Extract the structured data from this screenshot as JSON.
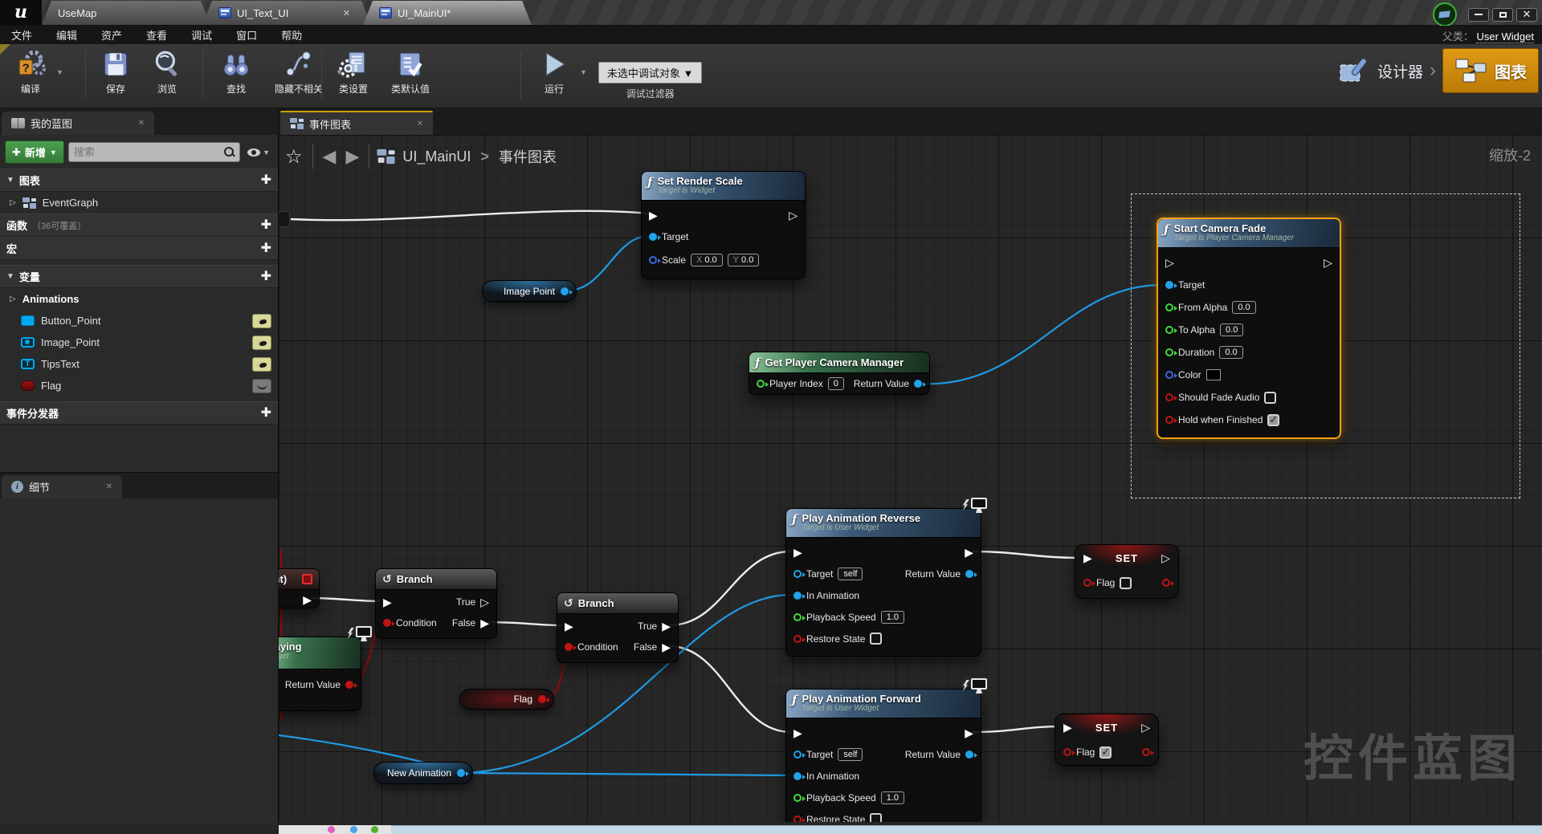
{
  "colors": {
    "accent_orange": "#e8940a",
    "selection_orange": "#f7a20c",
    "exec_wire": "#ececec",
    "object_pin_blue": "#22a3ea",
    "float_pin_green": "#41d93c",
    "bool_pin_red": "#c01414",
    "bool_wire_dark_red": "#8c0b0b",
    "pure_header_green": "#38714c",
    "function_header_blue": "#3c5a78",
    "add_button_green": "#4aa04e"
  },
  "titlebar": {
    "tabs": [
      {
        "label": "UseMap"
      },
      {
        "label": "UI_Text_UI"
      },
      {
        "label": "UI_MainUI*"
      }
    ]
  },
  "menu": {
    "items": [
      "文件",
      "编辑",
      "资产",
      "查看",
      "调试",
      "窗口",
      "帮助"
    ]
  },
  "toolbar": {
    "compile": "编译",
    "save": "保存",
    "browse": "浏览",
    "find": "查找",
    "hide_unrelated": "隐藏不相关",
    "class_settings": "类设置",
    "class_defaults": "类默认值",
    "play": "运行",
    "debug_object": "未选中调试对象 ▼",
    "debug_filter": "调试过滤器"
  },
  "header_right": {
    "parent_class_label": "父类：",
    "parent_class": "User Widget",
    "designer": "设计器",
    "graph": "图表"
  },
  "my_blueprint": {
    "title": "我的蓝图",
    "add_new": "新增",
    "search_placeholder": "搜索",
    "graphs_header": "图表",
    "event_graph": "EventGraph",
    "functions_header": "函数",
    "functions_hint": "（36可覆盖）",
    "macros_header": "宏",
    "variables_header": "变量",
    "animations_group": "Animations",
    "variables": [
      {
        "name": "Button_Point"
      },
      {
        "name": "Image_Point"
      },
      {
        "name": "TipsText"
      },
      {
        "name": "Flag"
      }
    ],
    "dispatchers_header": "事件分发器"
  },
  "details": {
    "title": "细节"
  },
  "graph": {
    "tab": "事件图表",
    "breadcrumb_root": "UI_MainUI",
    "breadcrumb_sep": ">",
    "breadcrumb_leaf": "事件图表",
    "zoom": "缩放-2",
    "watermark": "控件蓝图",
    "nodes": {
      "set_render_scale": {
        "title": "Set Render Scale",
        "subtitle": "Target is Widget",
        "target": "Target",
        "scale": "Scale",
        "x": "X",
        "x_value": "0.0",
        "y": "Y",
        "y_value": "0.0"
      },
      "image_point": {
        "label": "Image Point"
      },
      "get_pcm": {
        "title": "Get Player Camera Manager",
        "player_index": "Player Index",
        "player_index_value": "0",
        "return_value": "Return Value"
      },
      "start_camera_fade": {
        "title": "Start Camera Fade",
        "subtitle": "Target is Player Camera Manager",
        "selected": true,
        "target": "Target",
        "from_alpha": "From Alpha",
        "from_alpha_value": "0.0",
        "to_alpha": "To Alpha",
        "to_alpha_value": "0.0",
        "duration": "Duration",
        "duration_value": "0.0",
        "color": "Color",
        "should_fade_audio": "Should Fade Audio",
        "should_fade_audio_checked": false,
        "hold_when_finished": "Hold when Finished",
        "hold_when_finished_checked": true
      },
      "branch1": {
        "title": "Branch",
        "condition": "Condition",
        "true": "True",
        "false": "False"
      },
      "branch2": {
        "title": "Branch",
        "condition": "Condition",
        "true": "True",
        "false": "False"
      },
      "play_anim_reverse": {
        "title": "Play Animation Reverse",
        "subtitle": "Target is User Widget",
        "target": "Target",
        "target_value": "self",
        "in_animation": "In Animation",
        "playback_speed": "Playback Speed",
        "playback_speed_value": "1.0",
        "restore_state": "Restore State",
        "restore_state_checked": false,
        "return_value": "Return Value"
      },
      "play_anim_forward": {
        "title": "Play Animation Forward",
        "subtitle": "Target is User Widget",
        "target": "Target",
        "target_value": "self",
        "in_animation": "In Animation",
        "playback_speed": "Playback Speed",
        "playback_speed_value": "1.0",
        "restore_state": "Restore State",
        "restore_state_checked": false,
        "return_value": "Return Value"
      },
      "set1": {
        "title": "SET",
        "flag": "Flag",
        "checked": false
      },
      "set2": {
        "title": "SET",
        "flag": "Flag",
        "checked": true
      },
      "flag_pill": {
        "label": "Flag"
      },
      "new_animation_pill": {
        "label": "New Animation"
      },
      "playing_partial": {
        "title": "laying",
        "subtitle": "idget",
        "return_value": "Return Value"
      },
      "point_partial": {
        "title": "oint)"
      }
    }
  }
}
